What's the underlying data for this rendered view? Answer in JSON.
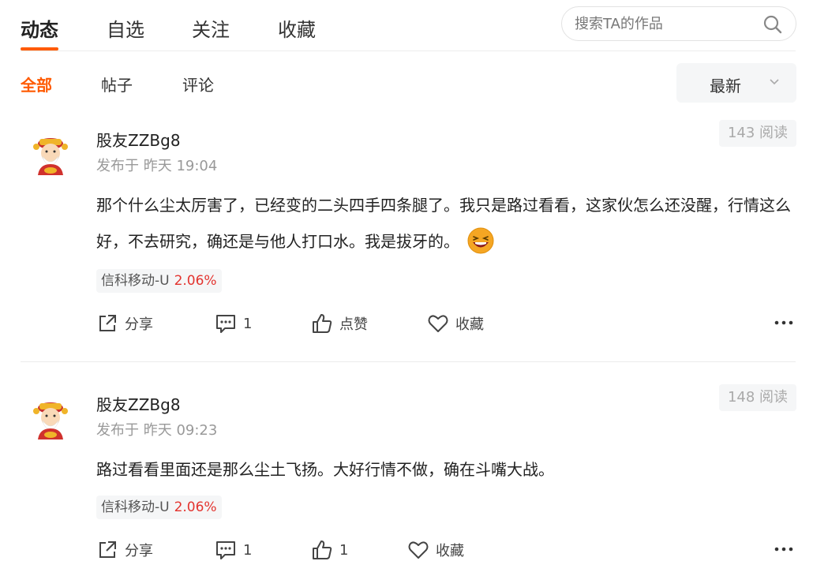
{
  "tabs": {
    "dynamic": "动态",
    "selected": "自选",
    "following": "关注",
    "favorites": "收藏"
  },
  "search": {
    "placeholder": "搜索TA的作品"
  },
  "filters": {
    "all": "全部",
    "posts": "帖子",
    "comments": "评论"
  },
  "sort": {
    "label": "最新"
  },
  "colors": {
    "accent": "#ff5a00",
    "stock_up": "#e3342f"
  },
  "posts": [
    {
      "author": "股友ZZBg8",
      "time": "发布于 昨天 19:04",
      "reads": "143 阅读",
      "content": "那个什么尘太厉害了，已经变的二头四手四条腿了。我只是路过看看，这家伙怎么还没醒，行情这么好，不去研究，确还是与他人打口水。我是拔牙的。",
      "emoji": "laughing-emoji",
      "stock": {
        "name": "信科移动-U",
        "change": "2.06%"
      },
      "actions": {
        "share": "分享",
        "comments": "1",
        "like": "点赞",
        "favorite": "收藏"
      }
    },
    {
      "author": "股友ZZBg8",
      "time": "发布于 昨天 09:23",
      "reads": "148 阅读",
      "content": "路过看看里面还是那么尘土飞扬。大好行情不做，确在斗嘴大战。",
      "stock": {
        "name": "信科移动-U",
        "change": "2.06%"
      },
      "actions": {
        "share": "分享",
        "comments": "1",
        "like": "1",
        "favorite": "收藏"
      }
    }
  ]
}
